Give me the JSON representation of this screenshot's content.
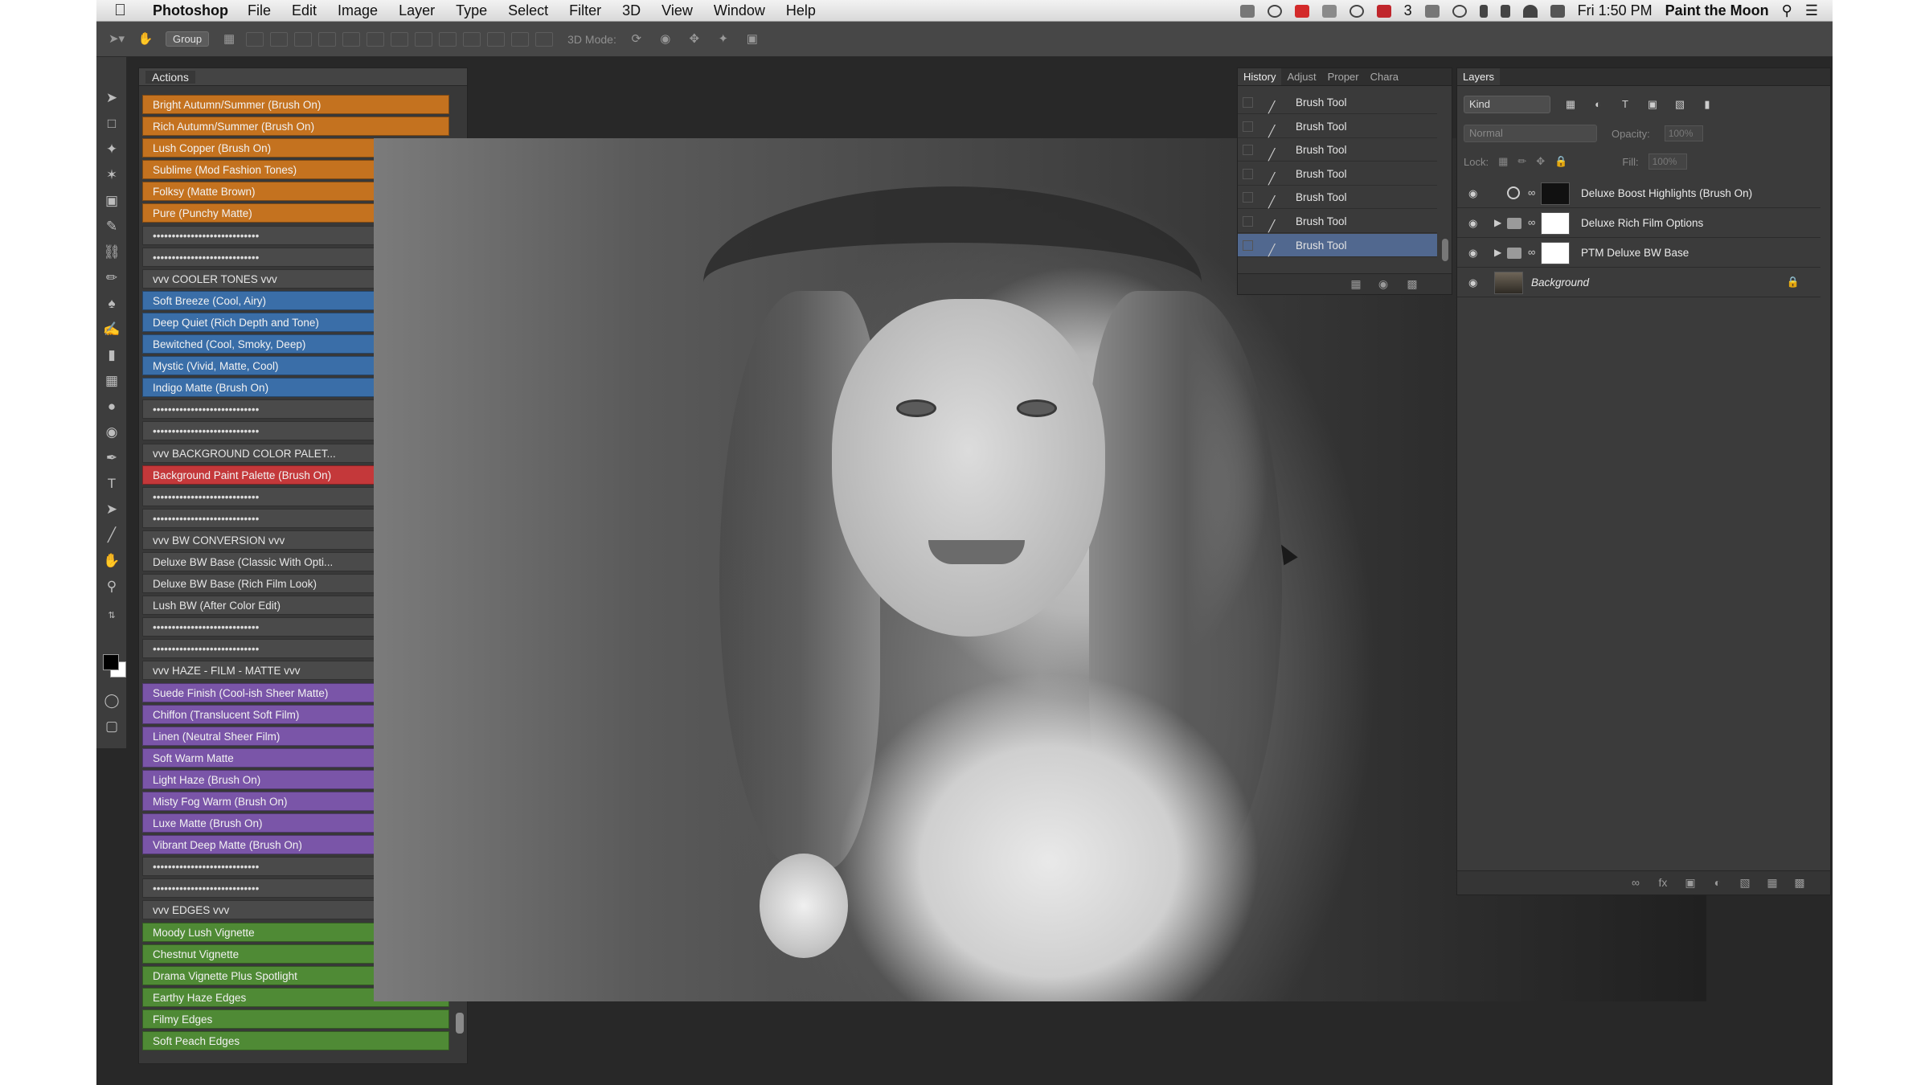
{
  "menubar": {
    "app_name": "Photoshop",
    "menus": [
      "File",
      "Edit",
      "Image",
      "Layer",
      "Type",
      "Select",
      "Filter",
      "3D",
      "View",
      "Window",
      "Help"
    ],
    "notification_count": "3",
    "clock": "Fri 1:50 PM",
    "user": "Paint the Moon"
  },
  "options_bar": {
    "group_label": "Group",
    "mode_label": "3D Mode:"
  },
  "actions_panel": {
    "title": "Actions",
    "items": [
      {
        "label": "Bright Autumn/Summer (Brush On)",
        "color": "orange"
      },
      {
        "label": "Rich Autumn/Summer (Brush On)",
        "color": "orange"
      },
      {
        "label": "Lush Copper (Brush On)",
        "color": "orange"
      },
      {
        "label": "Sublime (Mod Fashion Tones)",
        "color": "orange"
      },
      {
        "label": "Folksy (Matte Brown)",
        "color": "orange"
      },
      {
        "label": "Pure (Punchy Matte)",
        "color": "orange"
      },
      {
        "label": "••••••••••••••••••••••••••••",
        "color": "dots"
      },
      {
        "label": "••••••••••••••••••••••••••••",
        "color": "dots"
      },
      {
        "label": "vvv  COOLER TONES  vvv",
        "color": "gray"
      },
      {
        "label": "Soft Breeze (Cool, Airy)",
        "color": "blue"
      },
      {
        "label": "Deep Quiet (Rich Depth and Tone)",
        "color": "blue"
      },
      {
        "label": "Bewitched (Cool, Smoky, Deep)",
        "color": "blue"
      },
      {
        "label": "Mystic (Vivid, Matte, Cool)",
        "color": "blue"
      },
      {
        "label": "Indigo Matte (Brush On)",
        "color": "blue"
      },
      {
        "label": "••••••••••••••••••••••••••••",
        "color": "dots"
      },
      {
        "label": "••••••••••••••••••••••••••••",
        "color": "dots"
      },
      {
        "label": "vvv  BACKGROUND COLOR PALET...",
        "color": "gray"
      },
      {
        "label": "Background Paint Palette (Brush On)",
        "color": "red"
      },
      {
        "label": "••••••••••••••••••••••••••••",
        "color": "dots"
      },
      {
        "label": "••••••••••••••••••••••••••••",
        "color": "dots"
      },
      {
        "label": "vvv  BW CONVERSION  vvv",
        "color": "gray"
      },
      {
        "label": "Deluxe BW Base (Classic With Opti...",
        "color": "gray"
      },
      {
        "label": "Deluxe BW Base (Rich Film Look)",
        "color": "gray"
      },
      {
        "label": "Lush BW (After Color Edit)",
        "color": "gray"
      },
      {
        "label": "••••••••••••••••••••••••••••",
        "color": "dots"
      },
      {
        "label": "••••••••••••••••••••••••••••",
        "color": "dots"
      },
      {
        "label": "vvv  HAZE - FILM - MATTE vvv",
        "color": "gray"
      },
      {
        "label": "Suede Finish (Cool-ish Sheer Matte)",
        "color": "purple"
      },
      {
        "label": "Chiffon (Translucent Soft Film)",
        "color": "purple"
      },
      {
        "label": "Linen (Neutral Sheer Film)",
        "color": "purple"
      },
      {
        "label": "Soft Warm Matte",
        "color": "purple"
      },
      {
        "label": "Light Haze (Brush On)",
        "color": "purple"
      },
      {
        "label": "Misty Fog Warm (Brush On)",
        "color": "purple"
      },
      {
        "label": "Luxe Matte (Brush On)",
        "color": "purple"
      },
      {
        "label": "Vibrant Deep Matte (Brush On)",
        "color": "purple"
      },
      {
        "label": "••••••••••••••••••••••••••••",
        "color": "dots"
      },
      {
        "label": "••••••••••••••••••••••••••••",
        "color": "dots"
      },
      {
        "label": "vvv  EDGES  vvv",
        "color": "gray"
      },
      {
        "label": "Moody Lush Vignette",
        "color": "green"
      },
      {
        "label": "Chestnut Vignette",
        "color": "green"
      },
      {
        "label": "Drama Vignette Plus Spotlight",
        "color": "green"
      },
      {
        "label": "Earthy Haze Edges",
        "color": "green"
      },
      {
        "label": "Filmy Edges",
        "color": "green"
      },
      {
        "label": "Soft Peach Edges",
        "color": "green"
      }
    ]
  },
  "history_panel": {
    "tabs": [
      "History",
      "Adjust",
      "Proper",
      "Chara"
    ],
    "items": [
      {
        "label": "Brush Tool",
        "selected": false
      },
      {
        "label": "Brush Tool",
        "selected": false
      },
      {
        "label": "Brush Tool",
        "selected": false
      },
      {
        "label": "Brush Tool",
        "selected": false
      },
      {
        "label": "Brush Tool",
        "selected": false
      },
      {
        "label": "Brush Tool",
        "selected": false
      },
      {
        "label": "Brush Tool",
        "selected": true
      }
    ]
  },
  "layers_panel": {
    "title": "Layers",
    "kind_label": "Kind",
    "blend_mode": "Normal",
    "opacity_label": "Opacity:",
    "opacity_value": "100%",
    "lock_label": "Lock:",
    "fill_label": "Fill:",
    "fill_value": "100%",
    "layers": [
      {
        "name": "Deluxe Boost Highlights (Brush On)",
        "kind": "adjustment"
      },
      {
        "name": "Deluxe Rich Film Options",
        "kind": "group"
      },
      {
        "name": "PTM Deluxe BW Base",
        "kind": "group"
      },
      {
        "name": "Background",
        "kind": "background"
      }
    ]
  },
  "colors": {
    "orange": "#c4721f",
    "blue": "#3a6ea8",
    "red": "#c4383a",
    "purple": "#7a55a8",
    "green": "#4f8a35",
    "history_selected": "#51688f"
  }
}
